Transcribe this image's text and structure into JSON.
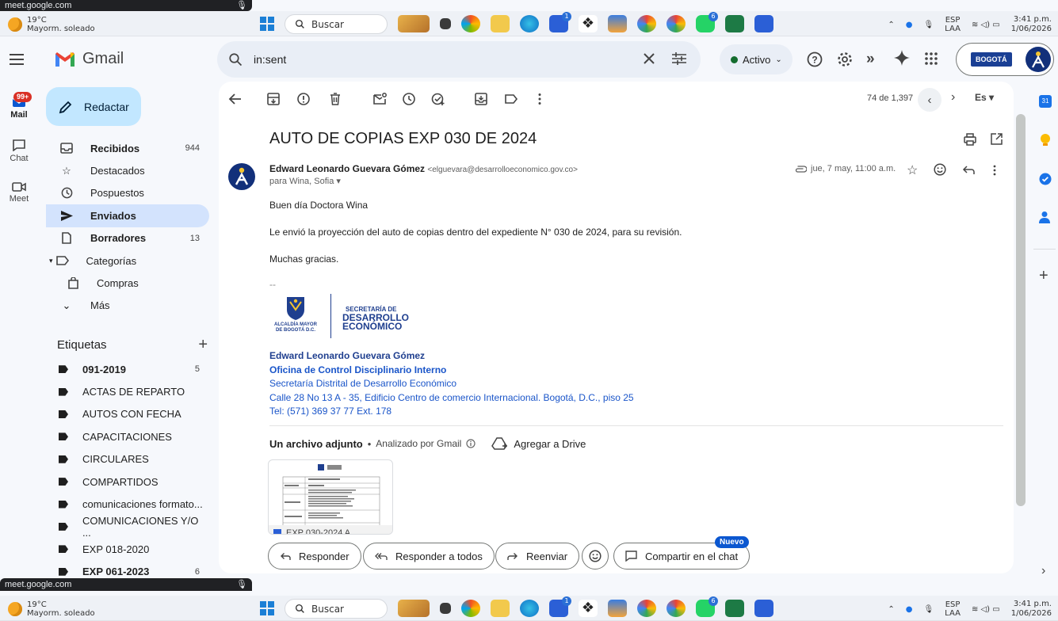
{
  "overlay_top": {
    "label": "meet.google.com"
  },
  "overlay_bottom": {
    "label": "meet.google.com"
  },
  "taskbar": {
    "temp": "19°C",
    "weather": "Mayorm. soleado",
    "search": "Buscar",
    "lang1": "ESP",
    "lang2": "LAA",
    "time": "3:41 p.m.",
    "date": "1/06/2026",
    "badges": {
      "a": "1",
      "b": "6"
    }
  },
  "header": {
    "app_name": "Gmail",
    "search_value": "in:sent",
    "status": "Activo",
    "org_badge": "BOGOTÁ"
  },
  "rail": {
    "mail_badge": "99+",
    "mail": "Mail",
    "chat": "Chat",
    "meet": "Meet"
  },
  "sidebar": {
    "compose": "Redactar",
    "items": [
      {
        "label": "Recibidos",
        "count": "944"
      },
      {
        "label": "Destacados",
        "count": ""
      },
      {
        "label": "Pospuestos",
        "count": ""
      },
      {
        "label": "Enviados",
        "count": ""
      },
      {
        "label": "Borradores",
        "count": "13"
      },
      {
        "label": "Categorías",
        "count": ""
      },
      {
        "label": "Compras",
        "count": ""
      },
      {
        "label": "Más",
        "count": ""
      }
    ],
    "labels_title": "Etiquetas",
    "labels": [
      {
        "label": "091-2019",
        "count": "5"
      },
      {
        "label": "ACTAS DE REPARTO",
        "count": ""
      },
      {
        "label": "AUTOS CON FECHA",
        "count": ""
      },
      {
        "label": "CAPACITACIONES",
        "count": ""
      },
      {
        "label": "CIRCULARES",
        "count": ""
      },
      {
        "label": "COMPARTIDOS",
        "count": ""
      },
      {
        "label": "comunicaciones formato...",
        "count": ""
      },
      {
        "label": "COMUNICACIONES Y/O ...",
        "count": ""
      },
      {
        "label": "EXP 018-2020",
        "count": ""
      },
      {
        "label": "EXP 061-2023",
        "count": "6"
      }
    ]
  },
  "toolbar": {
    "paging": "74 de 1,397",
    "lang": "Es"
  },
  "message": {
    "subject": "AUTO DE COPIAS EXP 030 DE 2024",
    "sender_name": "Edward Leonardo Guevara Gómez",
    "sender_email": "<elguevara@desarrolloeconomico.gov.co>",
    "to": "para Wina, Sofia",
    "date": "jue, 7 may, 11:00 a.m.",
    "body": [
      "Buen día Doctora Wina",
      "Le envió la proyección del auto de copias dentro del expediente N° 030 de 2024, para su revisión.",
      "Muchas gracias."
    ],
    "sig_sep": "--",
    "logo": {
      "left1": "ALCALDÍA MAYOR",
      "left2": "DE BOGOTÁ D.C.",
      "right1": "SECRETARÍA DE",
      "right2": "DESARROLLO",
      "right3": "ECONÓMICO"
    },
    "signature": {
      "name": "Edward Leonardo Guevara Gómez",
      "office": "Oficina de Control Disciplinario Interno",
      "entity": "Secretaría Distrital de Desarrollo Económico",
      "address": "Calle 28 No 13 A - 35, Edificio Centro de comercio Internacional. Bogotá, D.C., piso 25",
      "tel": "Tel: (571) 369 37 77 Ext. 178"
    },
    "attachments": {
      "title": "Un archivo adjunto",
      "scanned": "Analizado por Gmail",
      "drive": "Agregar a Drive",
      "file": "EXP 030-2024 A..."
    }
  },
  "actions": {
    "reply": "Responder",
    "reply_all": "Responder a todos",
    "forward": "Reenviar",
    "share": "Compartir en el chat",
    "new_badge": "Nuevo"
  },
  "colors": {
    "accent": "#0b57d0",
    "selected": "#d3e3fd",
    "compose": "#c2e7ff",
    "link": "#1a55c9",
    "status_dot": "#146c2e"
  }
}
